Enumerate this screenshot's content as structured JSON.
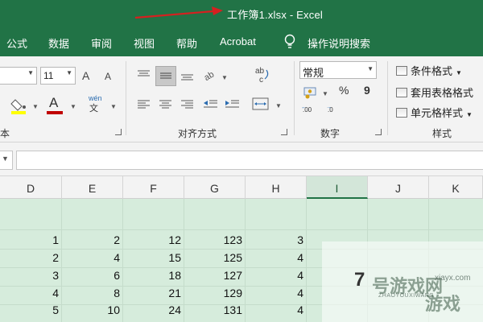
{
  "window": {
    "title": "工作簿1.xlsx  -  Excel"
  },
  "menu": {
    "items": [
      "公式",
      "数据",
      "审阅",
      "视图",
      "帮助",
      "Acrobat"
    ],
    "search_label": "操作说明搜索"
  },
  "ribbon": {
    "font_size_value": "11",
    "font_size_up": "A",
    "font_size_down": "A",
    "font_color_letter": "A",
    "phonetic_glyph": "wén",
    "phonetic_sub": "文",
    "wrap_text_glyph": "ab c",
    "number_format_value": "常规",
    "percent_symbol": "%",
    "comma_symbol": "9",
    "increase_decimal": ".00",
    "decrease_decimal": ".0",
    "group_font_label_partial": "本",
    "group_alignment_label": "对齐方式",
    "group_number_label": "数字",
    "group_styles_label": "样式",
    "conditional_format_label": "条件格式",
    "table_format_label": "套用表格格式",
    "cell_styles_label": "单元格样式"
  },
  "sheet": {
    "columns": [
      "D",
      "E",
      "F",
      "G",
      "H",
      "I",
      "J",
      "K"
    ],
    "selected_column": "I",
    "rows": [
      [
        "1",
        "2",
        "12",
        "123",
        "3"
      ],
      [
        "2",
        "4",
        "15",
        "125",
        "4"
      ],
      [
        "3",
        "6",
        "18",
        "127",
        "4"
      ],
      [
        "4",
        "8",
        "21",
        "129",
        "4"
      ],
      [
        "5",
        "10",
        "24",
        "131",
        "4"
      ]
    ],
    "cell_i_value": "7"
  },
  "colors": {
    "brand_green": "#217346",
    "selection_green": "#d6ecdc",
    "font_color_bar": "#c00000",
    "highlight_bar": "#ffff00",
    "annotation_arrow": "#d62020"
  },
  "watermark": {
    "brand": "号游戏网",
    "domain": "xiayx.com",
    "pinyin": "ZHAOYOUXIWANG",
    "game": "游戏"
  }
}
